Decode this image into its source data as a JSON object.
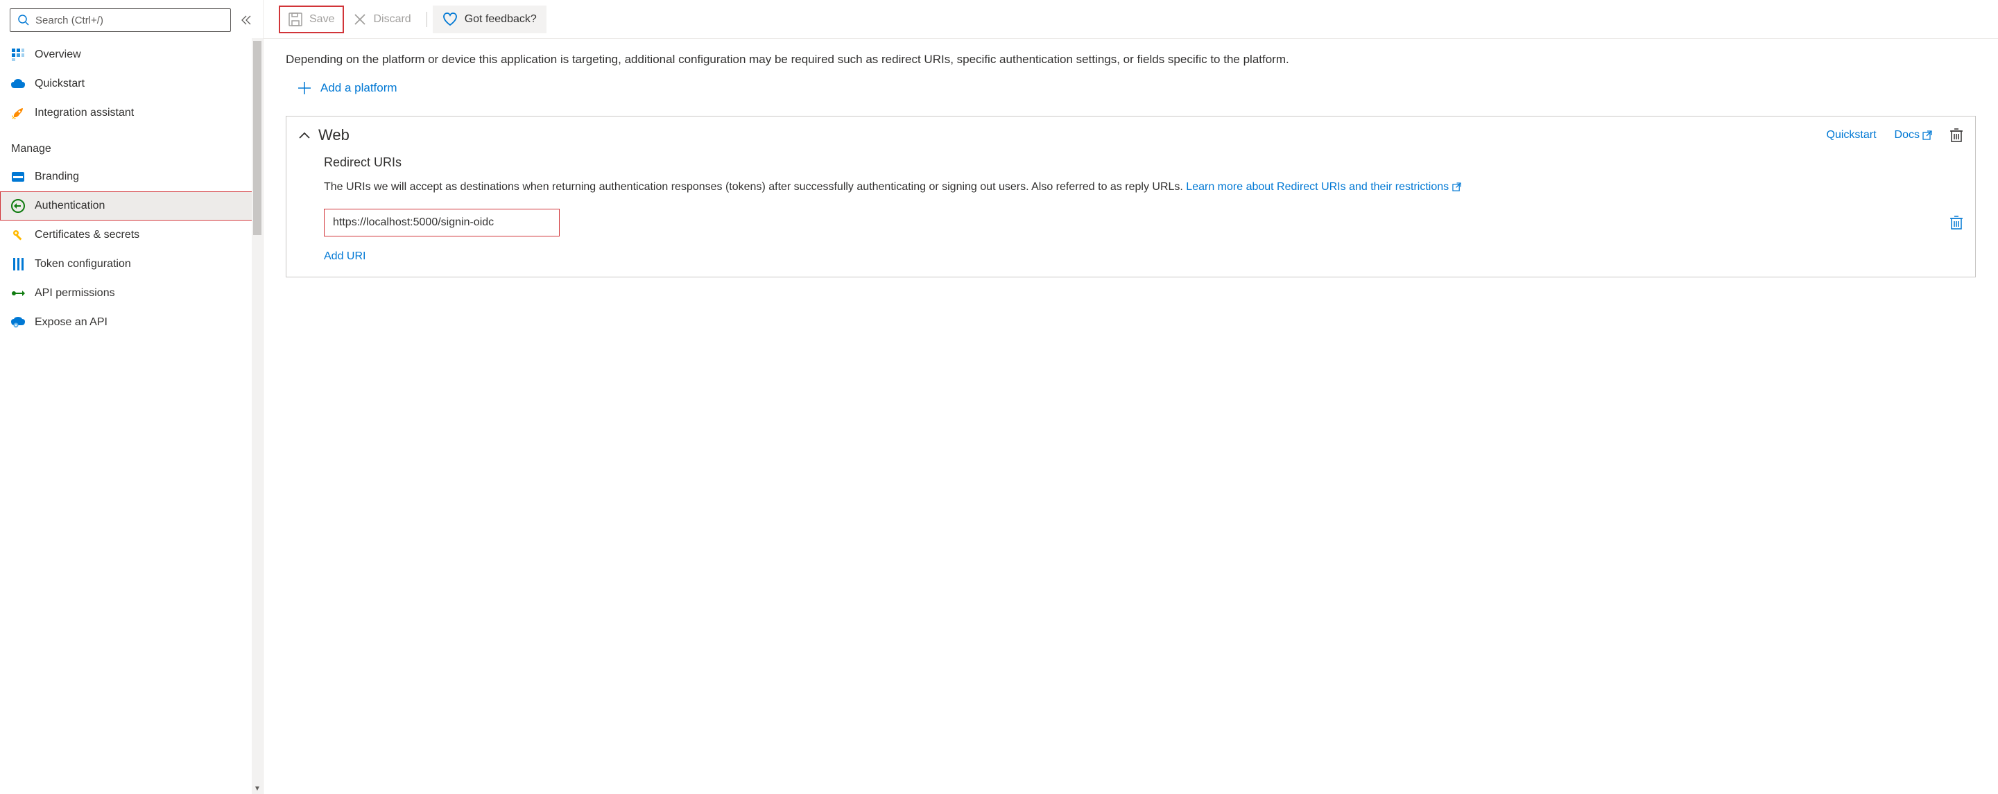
{
  "sidebar": {
    "search_placeholder": "Search (Ctrl+/)",
    "nav": [
      {
        "label": "Overview",
        "icon": "grid-icon"
      },
      {
        "label": "Quickstart",
        "icon": "cloud-icon"
      },
      {
        "label": "Integration assistant",
        "icon": "rocket-icon"
      }
    ],
    "section_label": "Manage",
    "manage": [
      {
        "label": "Branding",
        "icon": "brand-icon"
      },
      {
        "label": "Authentication",
        "icon": "key-circle-icon",
        "selected": true
      },
      {
        "label": "Certificates & secrets",
        "icon": "key-icon"
      },
      {
        "label": "Token configuration",
        "icon": "token-icon"
      },
      {
        "label": "API permissions",
        "icon": "api-permissions-icon"
      },
      {
        "label": "Expose an API",
        "icon": "cloud-gear-icon"
      }
    ]
  },
  "toolbar": {
    "save_label": "Save",
    "discard_label": "Discard",
    "feedback_label": "Got feedback?"
  },
  "content": {
    "description": "Depending on the platform or device this application is targeting, additional configuration may be required such as redirect URIs, specific authentication settings, or fields specific to the platform.",
    "add_platform_label": "Add a platform"
  },
  "platform": {
    "title": "Web",
    "quickstart_label": "Quickstart",
    "docs_label": "Docs",
    "redirect": {
      "title": "Redirect URIs",
      "desc_1": "The URIs we will accept as destinations when returning authentication responses (tokens) after successfully authenticating or signing out users. Also referred to as reply URLs. ",
      "learn_more_label": "Learn more about Redirect URIs and their restrictions",
      "uri_value": "https://localhost:5000/signin-oidc",
      "add_uri_label": "Add URI"
    }
  }
}
